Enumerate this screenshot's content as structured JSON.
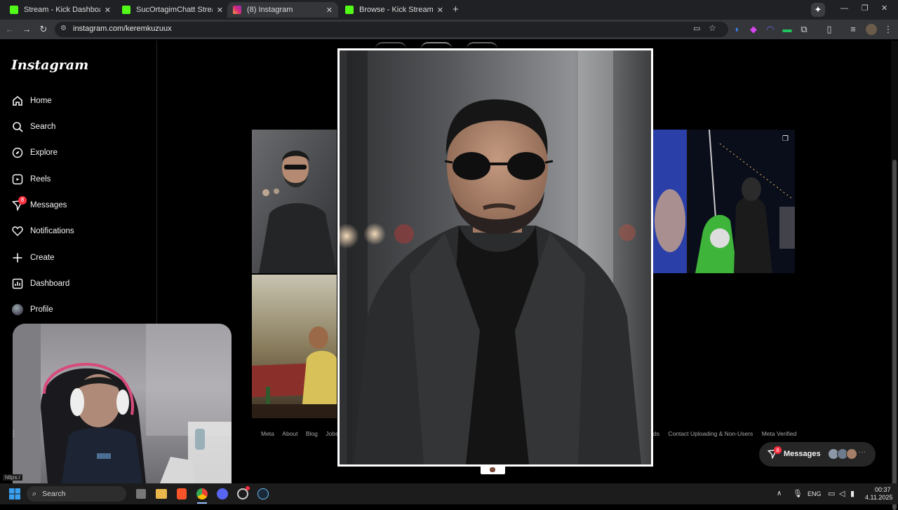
{
  "browser": {
    "tabs": [
      {
        "title": "Stream - Kick Dashboard",
        "icon": "kick-icon",
        "active": false
      },
      {
        "title": "SucOrtagimChatt Stream - Wat",
        "icon": "kick-icon",
        "active": false
      },
      {
        "title": "(8) Instagram",
        "icon": "instagram-icon",
        "active": true
      },
      {
        "title": "Browse - Kick Streaming",
        "icon": "kick-icon",
        "active": false
      }
    ],
    "new_tab": "+",
    "url": "instagram.com/keremkuzuux",
    "status_url": "https:/"
  },
  "sidebar": {
    "logo": "Instagram",
    "items": [
      {
        "label": "Home",
        "icon": "home-icon"
      },
      {
        "label": "Search",
        "icon": "search-icon"
      },
      {
        "label": "Explore",
        "icon": "compass-icon"
      },
      {
        "label": "Reels",
        "icon": "reels-icon"
      },
      {
        "label": "Messages",
        "icon": "messenger-icon",
        "badge": "8"
      },
      {
        "label": "Notifications",
        "icon": "heart-icon"
      },
      {
        "label": "Create",
        "icon": "plus-icon"
      },
      {
        "label": "Dashboard",
        "icon": "chart-icon"
      },
      {
        "label": "Profile",
        "icon": "avatar-icon"
      }
    ]
  },
  "footer": {
    "left": [
      "Meta",
      "About",
      "Blog",
      "Jobs"
    ],
    "right": [
      "ds",
      "Contact Uploading & Non-Users",
      "Meta Verified"
    ]
  },
  "messages_pill": {
    "label": "Messages",
    "badge": "8"
  },
  "taskbar": {
    "search_label": "Search",
    "lang": "ENG",
    "time": "00:37",
    "date": "4.11.2025"
  },
  "colors": {
    "badge": "#ff3040",
    "kick": "#53fc18",
    "tab_active": "#35363a"
  }
}
